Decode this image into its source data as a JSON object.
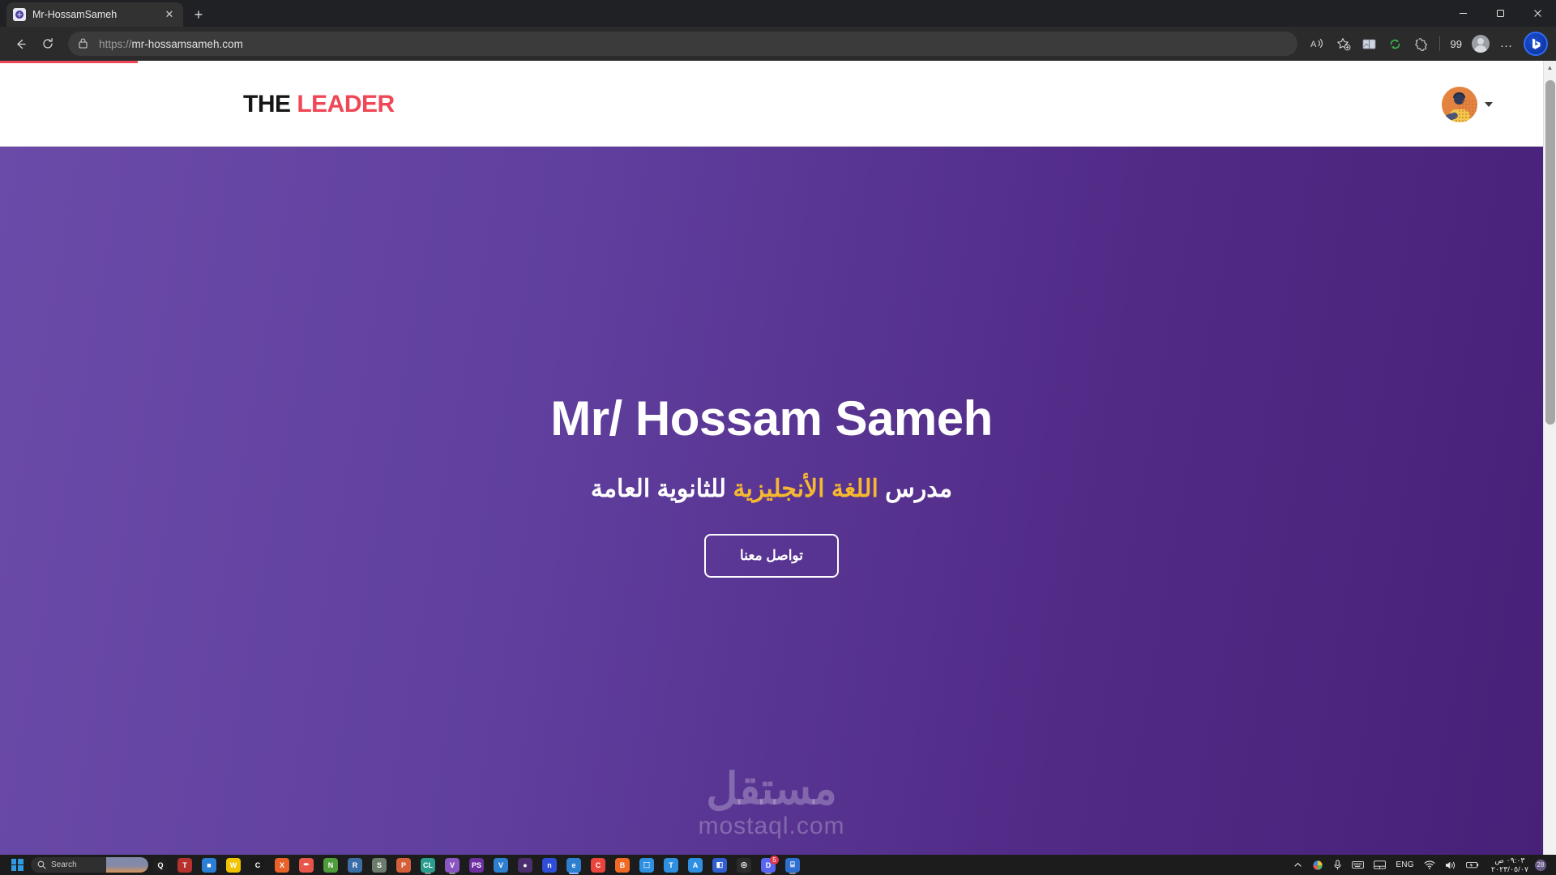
{
  "browser": {
    "tab": {
      "title": "Mr-HossamSameh",
      "favicon": "site-favicon",
      "close_label": "✕"
    },
    "new_tab_label": "+",
    "window_controls": {
      "minimize": "—",
      "maximize": "❐",
      "close": "✕"
    },
    "nav": {
      "back": "←",
      "reload": "↻"
    },
    "omnibox": {
      "scheme": "https://",
      "host": "mr-hossamsameh.com",
      "full_url": "https://mr-hossamsameh.com"
    },
    "toolbar_right": {
      "read_aloud": "A",
      "favorites": "star-plus",
      "split_screen": "split-screen",
      "sync": "sync",
      "browser_essentials": "essentials",
      "counter": "99",
      "profile": "profile",
      "more": "…",
      "copilot": "b"
    }
  },
  "site": {
    "logo": {
      "part1": "THE",
      "part2": "LEADER",
      "accent": "#ef4756"
    },
    "header": {
      "avatar_alt": "user-avatar",
      "dropdown": "chevron-down"
    },
    "hero": {
      "title": "Mr/ Hossam Sameh",
      "subtitle_before": "مدرس ",
      "subtitle_highlight": "اللغة الأنجليزية",
      "subtitle_after": " للثانوية العامة",
      "cta_label": "تواصل معنا",
      "gradient_from": "#6b4ba8",
      "gradient_to": "#472178",
      "highlight_color": "#f5b82e"
    },
    "watermark": {
      "arabic": "مستقل",
      "latin": "mostaql.com"
    }
  },
  "scrollbar": {
    "up_arrow": "▲"
  },
  "taskbar": {
    "start": "windows-start",
    "search": {
      "placeholder": "Search"
    },
    "apps": [
      {
        "name": "qt-app",
        "glyph": "Q",
        "color": "#1f1f1f",
        "open": false
      },
      {
        "name": "tor-browser",
        "glyph": "T",
        "color": "#b5322e",
        "open": false
      },
      {
        "name": "blue-app",
        "glyph": "■",
        "color": "#2b7fd4",
        "open": false
      },
      {
        "name": "winrar",
        "glyph": "W",
        "color": "#f2c300",
        "open": false
      },
      {
        "name": "chrome-canary",
        "glyph": "C",
        "color": "#1a1a1a",
        "open": false
      },
      {
        "name": "xampp",
        "glyph": "X",
        "color": "#e8622a",
        "open": false
      },
      {
        "name": "eyedropper",
        "glyph": "✒",
        "color": "#e8564b",
        "open": false
      },
      {
        "name": "nodejs",
        "glyph": "N",
        "color": "#4f9d3a",
        "open": false
      },
      {
        "name": "remote-desktop",
        "glyph": "R",
        "color": "#3a6ea5",
        "open": false
      },
      {
        "name": "security-app",
        "glyph": "S",
        "color": "#6d7b6d",
        "open": false
      },
      {
        "name": "photoshop-suite",
        "glyph": "P",
        "color": "#d4603a",
        "open": false
      },
      {
        "name": "clion",
        "glyph": "CL",
        "color": "#2a9d8f",
        "open": true
      },
      {
        "name": "visual-studio",
        "glyph": "V",
        "color": "#8a56c4",
        "open": true
      },
      {
        "name": "phpstorm",
        "glyph": "PS",
        "color": "#6b2fa0",
        "open": false
      },
      {
        "name": "vs-code",
        "glyph": "V",
        "color": "#2f7fd1",
        "open": false
      },
      {
        "name": "purple-app",
        "glyph": "●",
        "color": "#4a2e6e",
        "open": false
      },
      {
        "name": "notion",
        "glyph": "n",
        "color": "#2f4ed8",
        "open": false
      },
      {
        "name": "microsoft-edge",
        "glyph": "e",
        "color": "#2f7fd1",
        "open": true,
        "active": true
      },
      {
        "name": "google-chrome",
        "glyph": "C",
        "color": "#e9453c",
        "open": false
      },
      {
        "name": "brave-browser",
        "glyph": "B",
        "color": "#f06a26",
        "open": false
      },
      {
        "name": "screen-capture",
        "glyph": "⬚",
        "color": "#2f8fe0",
        "open": false
      },
      {
        "name": "teamviewer",
        "glyph": "T",
        "color": "#2f8fe0",
        "open": false
      },
      {
        "name": "anydesk",
        "glyph": "A",
        "color": "#2f8fe0",
        "open": false
      },
      {
        "name": "sticky-app",
        "glyph": "◧",
        "color": "#2f5fd0",
        "open": false
      },
      {
        "name": "obs-studio",
        "glyph": "◎",
        "color": "#2b2b2b",
        "open": false
      },
      {
        "name": "discord",
        "glyph": "D",
        "color": "#5865f2",
        "open": true,
        "badge": "5"
      },
      {
        "name": "calculator",
        "glyph": "⌸",
        "color": "#2f6fd0",
        "open": true
      }
    ],
    "tray": {
      "overflow": "⌃",
      "graphics": "graphics-icon",
      "microphone": "mic-icon",
      "keyboard": "keyboard-icon",
      "touchpad": "touchpad-icon",
      "language": "ENG",
      "wifi": "wifi-icon",
      "volume": "speaker-icon",
      "battery": "battery-icon",
      "time": "٠٩:٠٣ ص",
      "date": "٢٠٢٣/٠٥/٠٧",
      "notifications": "28"
    }
  }
}
